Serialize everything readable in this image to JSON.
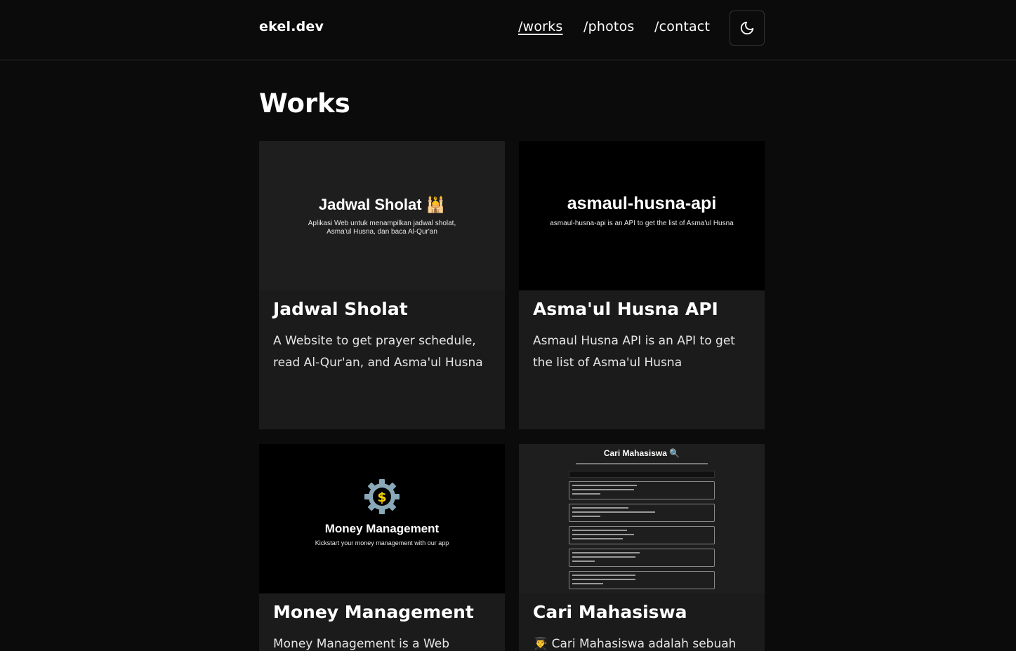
{
  "header": {
    "brand": "ekel.dev",
    "nav": [
      {
        "label": "/works",
        "active": true
      },
      {
        "label": "/photos",
        "active": false
      },
      {
        "label": "/contact",
        "active": false
      }
    ],
    "theme_toggle_icon": "moon-icon"
  },
  "page": {
    "title": "Works"
  },
  "works": [
    {
      "title": "Jadwal Sholat",
      "description": "A Website to get prayer schedule, read Al-Qur'an, and Asma'ul Husna",
      "image": {
        "title": "Jadwal Sholat 🕌",
        "subtitle_line1": "Aplikasi Web untuk menampilkan jadwal sholat,",
        "subtitle_line2": "Asma'ul Husna, dan baca Al-Qur'an"
      }
    },
    {
      "title": "Asma'ul Husna API",
      "description": "Asmaul Husna API is an API to get the list of Asma'ul Husna",
      "image": {
        "title": "asmaul-husna-api",
        "subtitle": "asmaul-husna-api is an API to get the list of Asma'ul Husna"
      }
    },
    {
      "title": "Money Management",
      "description": "Money Management is a Web",
      "image": {
        "icon": "dollar-gear-icon",
        "title": "Money Management",
        "subtitle": "Kickstart your money management with our app"
      }
    },
    {
      "title": "Cari Mahasiswa",
      "description": "👨‍🎓 Cari Mahasiswa adalah sebuah",
      "image": {
        "title": "Cari Mahasiswa 🔍"
      }
    }
  ],
  "colors": {
    "background": "#0b0b0b",
    "card": "#1b1b1b",
    "gear": "#8aa9b8",
    "dollar": "#f5d300"
  }
}
